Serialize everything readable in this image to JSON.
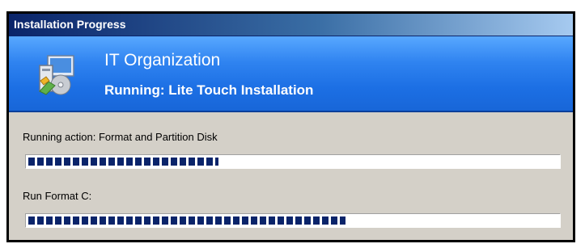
{
  "window": {
    "title": "Installation Progress"
  },
  "banner": {
    "organization": "IT Organization",
    "running_task": "Running: Lite Touch Installation",
    "icon": "installer-computer-cd-icon"
  },
  "progress": {
    "action_label": "Running action: Format and Partition Disk",
    "action_progress_fraction": 0.36,
    "step_label": "Run Format C:",
    "step_progress_fraction": 0.6
  },
  "colors": {
    "title_bar": "#0a246a",
    "banner": "#1c6fe4",
    "progress_block": "#0a246a",
    "window_face": "#d4d0c8"
  }
}
